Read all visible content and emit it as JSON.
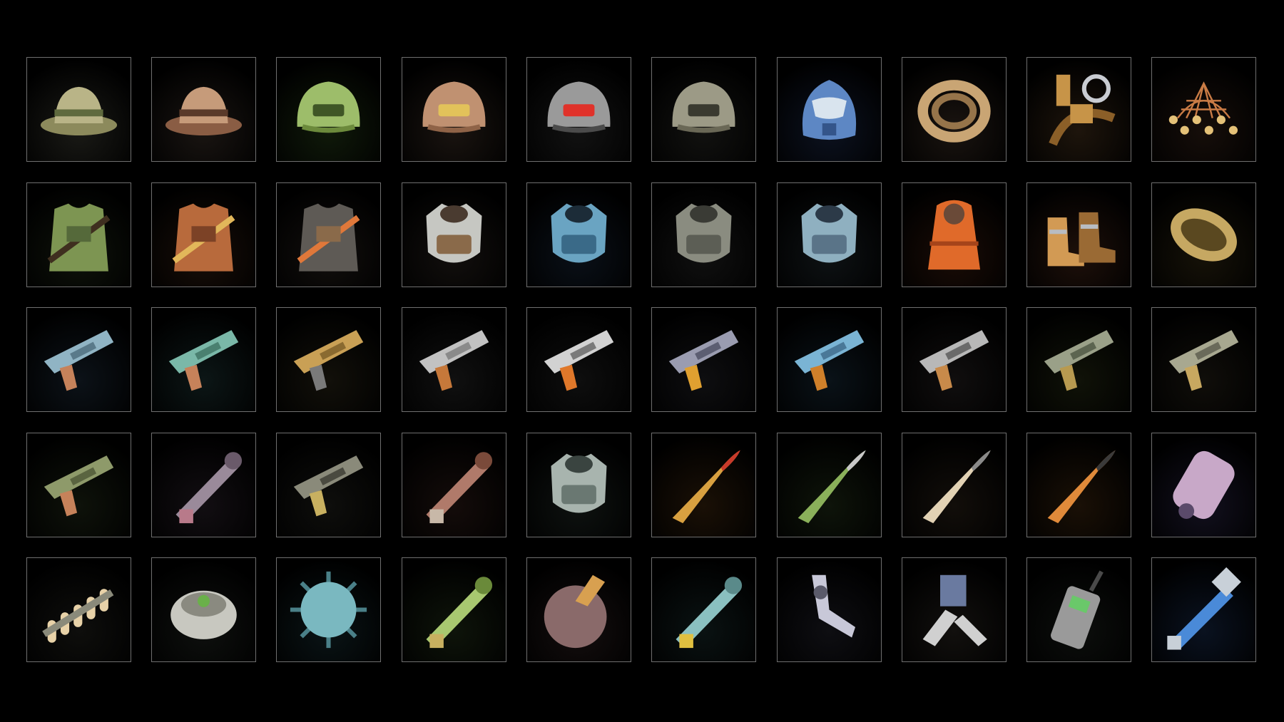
{
  "inventory": {
    "rows": [
      [
        {
          "icon": "bucket-hat-icon",
          "glow": "#1a1a16",
          "colors": [
            "#b9b487",
            "#8c8a5c",
            "#5f6a3e"
          ]
        },
        {
          "icon": "goggles-cap-icon",
          "glow": "#1a1512",
          "colors": [
            "#c69b7a",
            "#8a5d44",
            "#5a3a2a"
          ]
        },
        {
          "icon": "army-helmet-icon",
          "glow": "#101a0a",
          "colors": [
            "#9dbd6a",
            "#6c8a3c",
            "#3f5626"
          ]
        },
        {
          "icon": "visor-helmet-icon",
          "glow": "#1a1410",
          "colors": [
            "#c09171",
            "#8f6347",
            "#e2c25a"
          ]
        },
        {
          "icon": "tech-helmet-icon",
          "glow": "#121212",
          "colors": [
            "#9a9a9a",
            "#4b4b4b",
            "#e0322a"
          ]
        },
        {
          "icon": "pilot-helmet-icon",
          "glow": "#121210",
          "colors": [
            "#9c9a86",
            "#6a6856",
            "#3a3a30"
          ]
        },
        {
          "icon": "gas-mask-helmet-icon",
          "glow": "#0c1220",
          "colors": [
            "#5d87c4",
            "#34558a",
            "#d9e4ee"
          ]
        },
        {
          "icon": "rope-coil-icon",
          "glow": "#1a1410",
          "colors": [
            "#c9a574",
            "#96744a",
            "#6a5034"
          ]
        },
        {
          "icon": "carabiner-strap-icon",
          "glow": "#1e150c",
          "colors": [
            "#c79448",
            "#8b5f28",
            "#c9ccd2"
          ]
        },
        {
          "icon": "net-icon",
          "glow": "#160e0a",
          "colors": [
            "#c97b45",
            "#e4c178",
            "#7a4425"
          ]
        }
      ],
      [
        {
          "icon": "green-vest-icon",
          "glow": "#0e120a",
          "colors": [
            "#7d9552",
            "#55693a",
            "#3f2f1f"
          ]
        },
        {
          "icon": "leather-jacket-icon",
          "glow": "#180e08",
          "colors": [
            "#b86a3c",
            "#7c4226",
            "#e2b75a"
          ]
        },
        {
          "icon": "bomber-jacket-icon",
          "glow": "#120f0d",
          "colors": [
            "#5e5a55",
            "#8a6a4a",
            "#e0783a"
          ]
        },
        {
          "icon": "padded-armor-icon",
          "glow": "#120f0d",
          "colors": [
            "#c6c7c2",
            "#8a6a4a",
            "#4a3b30"
          ]
        },
        {
          "icon": "blue-power-armor-icon",
          "glow": "#0a1018",
          "colors": [
            "#6aa4c2",
            "#3a6a88",
            "#1c2c38"
          ]
        },
        {
          "icon": "heavy-plate-armor-icon",
          "glow": "#101010",
          "colors": [
            "#8a8c80",
            "#5c5e55",
            "#3a3b35"
          ]
        },
        {
          "icon": "steel-plate-armor-icon",
          "glow": "#0e1214",
          "colors": [
            "#8fb0c0",
            "#5a7488",
            "#2c3a48"
          ]
        },
        {
          "icon": "hazmat-suit-icon",
          "glow": "#1a0c06",
          "colors": [
            "#e06a2a",
            "#a5441a",
            "#6a4a38"
          ]
        },
        {
          "icon": "boots-icon",
          "glow": "#1e100a",
          "colors": [
            "#d29a54",
            "#9a6a34",
            "#b8bcc2"
          ]
        },
        {
          "icon": "ghillie-wrap-icon",
          "glow": "#161208",
          "colors": [
            "#c6a862",
            "#8f7438",
            "#5a4820"
          ]
        }
      ],
      [
        {
          "icon": "blaster-pistol-icon",
          "glow": "#0c1218",
          "colors": [
            "#90b4c4",
            "#5a7a8a",
            "#c6825a"
          ]
        },
        {
          "icon": "teal-pistol-icon",
          "glow": "#0c1616",
          "colors": [
            "#7ab8a8",
            "#4a8070",
            "#c6825a"
          ]
        },
        {
          "icon": "gold-revolver-icon",
          "glow": "#12100a",
          "colors": [
            "#c9a055",
            "#8a6a30",
            "#7a7a7a"
          ]
        },
        {
          "icon": "scrap-smg-icon",
          "glow": "#101010",
          "colors": [
            "#c2c2c2",
            "#8a8a8a",
            "#c6783a"
          ]
        },
        {
          "icon": "assault-rifle-icon",
          "glow": "#0e0e0e",
          "colors": [
            "#d2d2d2",
            "#7a7a7a",
            "#e0782a"
          ]
        },
        {
          "icon": "heavy-rifle-icon",
          "glow": "#0e0e10",
          "colors": [
            "#9a9cb0",
            "#5c5e72",
            "#e0a030"
          ]
        },
        {
          "icon": "blue-rifle-icon",
          "glow": "#0a1218",
          "colors": [
            "#7ab4d4",
            "#4a7898",
            "#d0802a"
          ]
        },
        {
          "icon": "hunting-rifle-icon",
          "glow": "#100e0e",
          "colors": [
            "#b8b8b8",
            "#6a6a6a",
            "#c88a4a"
          ]
        },
        {
          "icon": "sniper-rifle-icon",
          "glow": "#101208",
          "colors": [
            "#9aa088",
            "#5c6450",
            "#b89a50"
          ]
        },
        {
          "icon": "ak-rifle-icon",
          "glow": "#100e0a",
          "colors": [
            "#a8a890",
            "#6a6a5a",
            "#c8a860"
          ]
        }
      ],
      [
        {
          "icon": "green-pistol-icon",
          "glow": "#0e120a",
          "colors": [
            "#8e9a6a",
            "#5a6440",
            "#c6825a"
          ]
        },
        {
          "icon": "rocket-launcher-icon",
          "glow": "#120e12",
          "colors": [
            "#9a8a9a",
            "#6a5a6a",
            "#b87a8a"
          ]
        },
        {
          "icon": "machine-gun-icon",
          "glow": "#0e0e0c",
          "colors": [
            "#8a8a7a",
            "#4a4a40",
            "#c8b060"
          ]
        },
        {
          "icon": "minigun-icon",
          "glow": "#140c0a",
          "colors": [
            "#b07a6a",
            "#7a4a3a",
            "#c8b8a8"
          ]
        },
        {
          "icon": "turret-cannon-icon",
          "glow": "#0e1210",
          "colors": [
            "#a8b4ae",
            "#6a7872",
            "#3a4440"
          ]
        },
        {
          "icon": "bullet-round-icon",
          "glow": "#1a1006",
          "colors": [
            "#d8a040",
            "#8a5a1a",
            "#c83a2a"
          ]
        },
        {
          "icon": "rpg-rocket-icon",
          "glow": "#0e140a",
          "colors": [
            "#8ab05a",
            "#5a7a3a",
            "#c8c8c8"
          ]
        },
        {
          "icon": "mortar-shell-icon",
          "glow": "#120e0a",
          "colors": [
            "#e2d2b4",
            "#a88a6a",
            "#8a8a8a"
          ]
        },
        {
          "icon": "artillery-shell-icon",
          "glow": "#1a1006",
          "colors": [
            "#e08a3a",
            "#9a5a1a",
            "#3a3a3a"
          ]
        },
        {
          "icon": "fuel-canister-icon",
          "glow": "#12101e",
          "colors": [
            "#c8a8c8",
            "#8a6a8a",
            "#5a4a6a"
          ]
        }
      ],
      [
        {
          "icon": "ammo-belt-icon",
          "glow": "#0e0e0c",
          "colors": [
            "#e8d2a8",
            "#8a8a7a",
            "#4a4a40"
          ]
        },
        {
          "icon": "landmine-icon",
          "glow": "#0e100e",
          "colors": [
            "#c8c8c0",
            "#8a8a80",
            "#6ab04a"
          ]
        },
        {
          "icon": "naval-mine-icon",
          "glow": "#0a1416",
          "colors": [
            "#7ab8c0",
            "#4a8088",
            "#2a4850"
          ]
        },
        {
          "icon": "grenade-icon",
          "glow": "#0e140a",
          "colors": [
            "#a8c870",
            "#6a8a3a",
            "#c8b060"
          ]
        },
        {
          "icon": "bomb-icon",
          "glow": "#140e0e",
          "colors": [
            "#8a6a6a",
            "#5a3a3a",
            "#d8a050"
          ]
        },
        {
          "icon": "chainsaw-icon",
          "glow": "#0a1212",
          "colors": [
            "#8ac0c0",
            "#5a8a8a",
            "#e0c040"
          ]
        },
        {
          "icon": "robot-arm-icon",
          "glow": "#0e0e12",
          "colors": [
            "#c8c8d8",
            "#8a8a9a",
            "#5a5a6a"
          ]
        },
        {
          "icon": "robot-legs-icon",
          "glow": "#12100e",
          "colors": [
            "#d0d0d0",
            "#6a7aa0",
            "#c8782a"
          ]
        },
        {
          "icon": "walkie-talkie-icon",
          "glow": "#0c0e0c",
          "colors": [
            "#9a9a9a",
            "#4a4a4a",
            "#6ac86a"
          ]
        },
        {
          "icon": "syringe-icon",
          "glow": "#0a1220",
          "colors": [
            "#4a8ad8",
            "#2a5a9a",
            "#c8d0d8"
          ]
        }
      ]
    ]
  }
}
